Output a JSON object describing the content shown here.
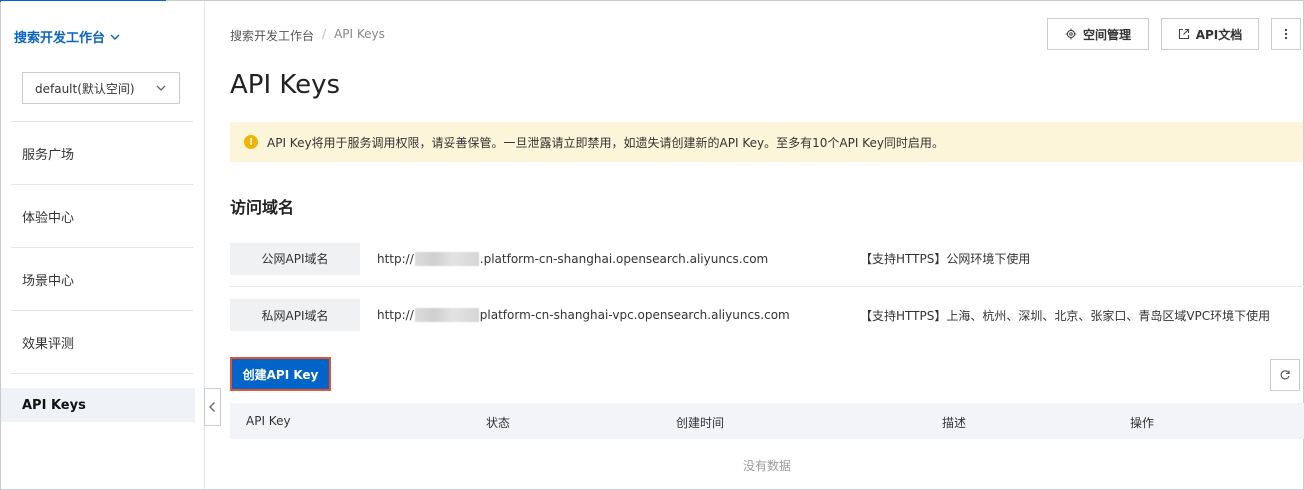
{
  "sidebar": {
    "workspace_title": "搜索开发工作台",
    "workspace_select": "default(默认空间)",
    "items": [
      {
        "label": "服务广场"
      },
      {
        "label": "体验中心"
      },
      {
        "label": "场景中心"
      },
      {
        "label": "效果评测"
      },
      {
        "label": "API Keys",
        "active": true
      }
    ]
  },
  "breadcrumb": {
    "root": "搜索开发工作台",
    "separator": "/",
    "current": "API Keys"
  },
  "page_title": "API Keys",
  "top_actions": {
    "space_manage": "空间管理",
    "api_doc": "API文档"
  },
  "alert": {
    "text": "API Key将用于服务调用权限，请妥善保管。一旦泄露请立即禁用，如遗失请创建新的API Key。至多有10个API Key同时启用。"
  },
  "access_domain": {
    "title": "访问域名",
    "rows": [
      {
        "label": "公网API域名",
        "url_prefix": "http://",
        "url_suffix": ".platform-cn-shanghai.opensearch.aliyuncs.com",
        "note": "【支持HTTPS】公网环境下使用"
      },
      {
        "label": "私网API域名",
        "url_prefix": "http://",
        "url_suffix": "platform-cn-shanghai-vpc.opensearch.aliyuncs.com",
        "note": "【支持HTTPS】上海、杭州、深圳、北京、张家口、青岛区域VPC环境下使用"
      }
    ]
  },
  "create_button": "创建API Key",
  "table": {
    "columns": [
      "API Key",
      "状态",
      "创建时间",
      "描述",
      "操作"
    ],
    "empty_text": "没有数据"
  },
  "colors": {
    "primary": "#0064c8",
    "highlight_border": "#e2542c",
    "alert_bg": "#fdf5d9",
    "warning_icon": "#f0b500"
  }
}
